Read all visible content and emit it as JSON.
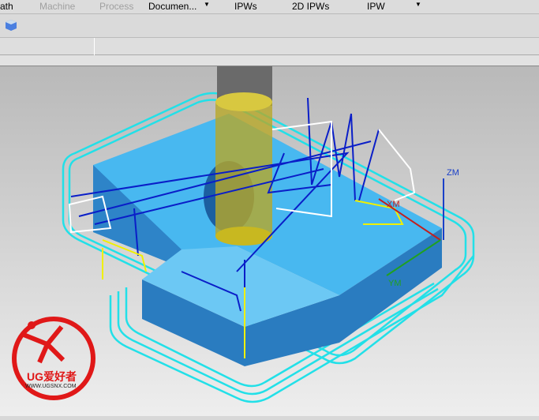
{
  "toolbar": {
    "path": "ath",
    "machine": "Machine",
    "process": "Process",
    "document": "Documen...",
    "ipws": "IPWs",
    "ipws2d": "2D IPWs",
    "ipw": "IPW"
  },
  "axes": {
    "z": "ZM",
    "x": "XM",
    "y": "YM"
  },
  "watermark": {
    "brand": "UG爱好者",
    "url": "WWW.UGSNX.COM"
  },
  "colors": {
    "toolpath": "#22e0e8",
    "cut": "#0a1ec8",
    "part": "#3aa8e8",
    "tool": "#c8b820"
  }
}
